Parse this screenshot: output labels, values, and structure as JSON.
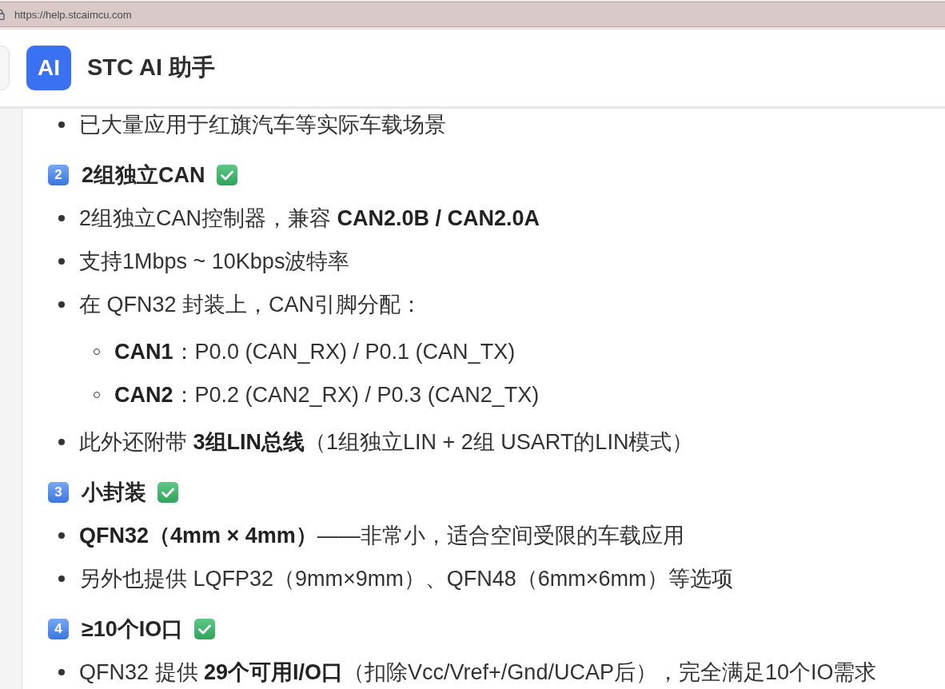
{
  "browser": {
    "url": "https://help.stcaimcu.com"
  },
  "header": {
    "logo": "AI",
    "title": "STC AI 助手"
  },
  "content": [
    {
      "kind": "list",
      "items": [
        {
          "text": "已大量应用于红旗汽车等实际车载场景"
        }
      ]
    },
    {
      "kind": "heading",
      "number": "2",
      "text": "2组独立CAN",
      "checked": true
    },
    {
      "kind": "list",
      "items": [
        {
          "text": "2组独立CAN控制器，兼容 **CAN2.0B / CAN2.0A**"
        },
        {
          "text": "支持1Mbps ~ 10Kbps波特率"
        },
        {
          "text": "在 QFN32 封装上，CAN引脚分配：",
          "children": [
            {
              "text": "**CAN1**：P0.0 (CAN_RX) / P0.1 (CAN_TX)"
            },
            {
              "text": "**CAN2**：P0.2 (CAN2_RX) / P0.3 (CAN2_TX)"
            }
          ]
        },
        {
          "text": "此外还附带 **3组LIN总线**（1组独立LIN + 2组 USART的LIN模式）"
        }
      ]
    },
    {
      "kind": "heading",
      "number": "3",
      "text": "小封装",
      "checked": true
    },
    {
      "kind": "list",
      "items": [
        {
          "text": "**QFN32（4mm × 4mm）**——非常小，适合空间受限的车载应用"
        },
        {
          "text": "另外也提供 LQFP32（9mm×9mm）、QFN48（6mm×6mm）等选项"
        }
      ]
    },
    {
      "kind": "heading",
      "number": "4",
      "text": "≥10个IO口",
      "checked": true
    },
    {
      "kind": "list",
      "items": [
        {
          "text": "QFN32 提供 **29个可用I/O口**（扣除Vcc/Vref+/Gnd/UCAP后），完全满足10个IO需求"
        }
      ]
    }
  ]
}
